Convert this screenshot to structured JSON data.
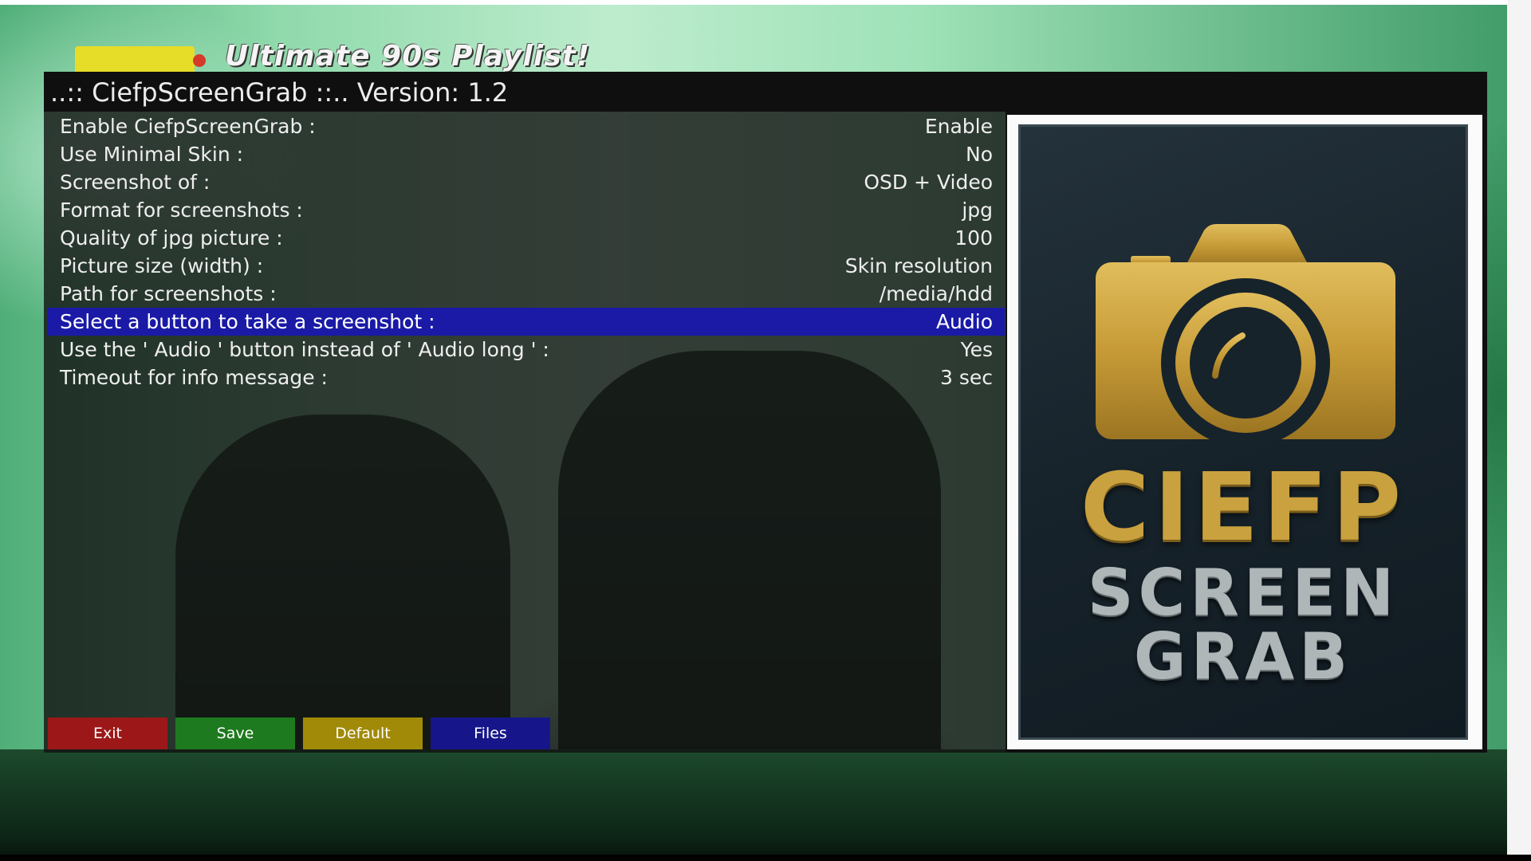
{
  "video": {
    "caption": "Ultimate 90s Playlist!"
  },
  "window": {
    "title": "..:: CiefpScreenGrab ::.. Version: 1.2"
  },
  "settings": [
    {
      "label": "Enable CiefpScreenGrab :",
      "value": "Enable",
      "selected": false
    },
    {
      "label": "Use Minimal Skin :",
      "value": "No",
      "selected": false
    },
    {
      "label": "Screenshot of :",
      "value": "OSD + Video",
      "selected": false
    },
    {
      "label": "Format for screenshots :",
      "value": "jpg",
      "selected": false
    },
    {
      "label": "Quality of jpg picture :",
      "value": "100",
      "selected": false
    },
    {
      "label": "Picture size (width) :",
      "value": "Skin resolution",
      "selected": false
    },
    {
      "label": "Path for screenshots :",
      "value": "/media/hdd",
      "selected": false
    },
    {
      "label": "Select a button to take a screenshot :",
      "value": "Audio",
      "selected": true
    },
    {
      "label": "Use the ' Audio ' button instead of ' Audio long ' :",
      "value": "Yes",
      "selected": false
    },
    {
      "label": "Timeout for info message :",
      "value": "3 sec",
      "selected": false
    }
  ],
  "buttons": {
    "red": {
      "label": "Exit",
      "color": "#9c1818"
    },
    "green": {
      "label": "Save",
      "color": "#1e7a1e"
    },
    "yellow": {
      "label": "Default",
      "color": "#a08a08"
    },
    "blue": {
      "label": "Files",
      "color": "#16168a"
    }
  },
  "preview": {
    "icon": "camera-icon",
    "logo_line1": "CIEFP",
    "logo_line2": "SCREEN",
    "logo_line3": "GRAB"
  },
  "colors": {
    "selection": "#1a1aa6",
    "logo_gold": "#c9a13e",
    "logo_silver": "#aeb6b8"
  }
}
